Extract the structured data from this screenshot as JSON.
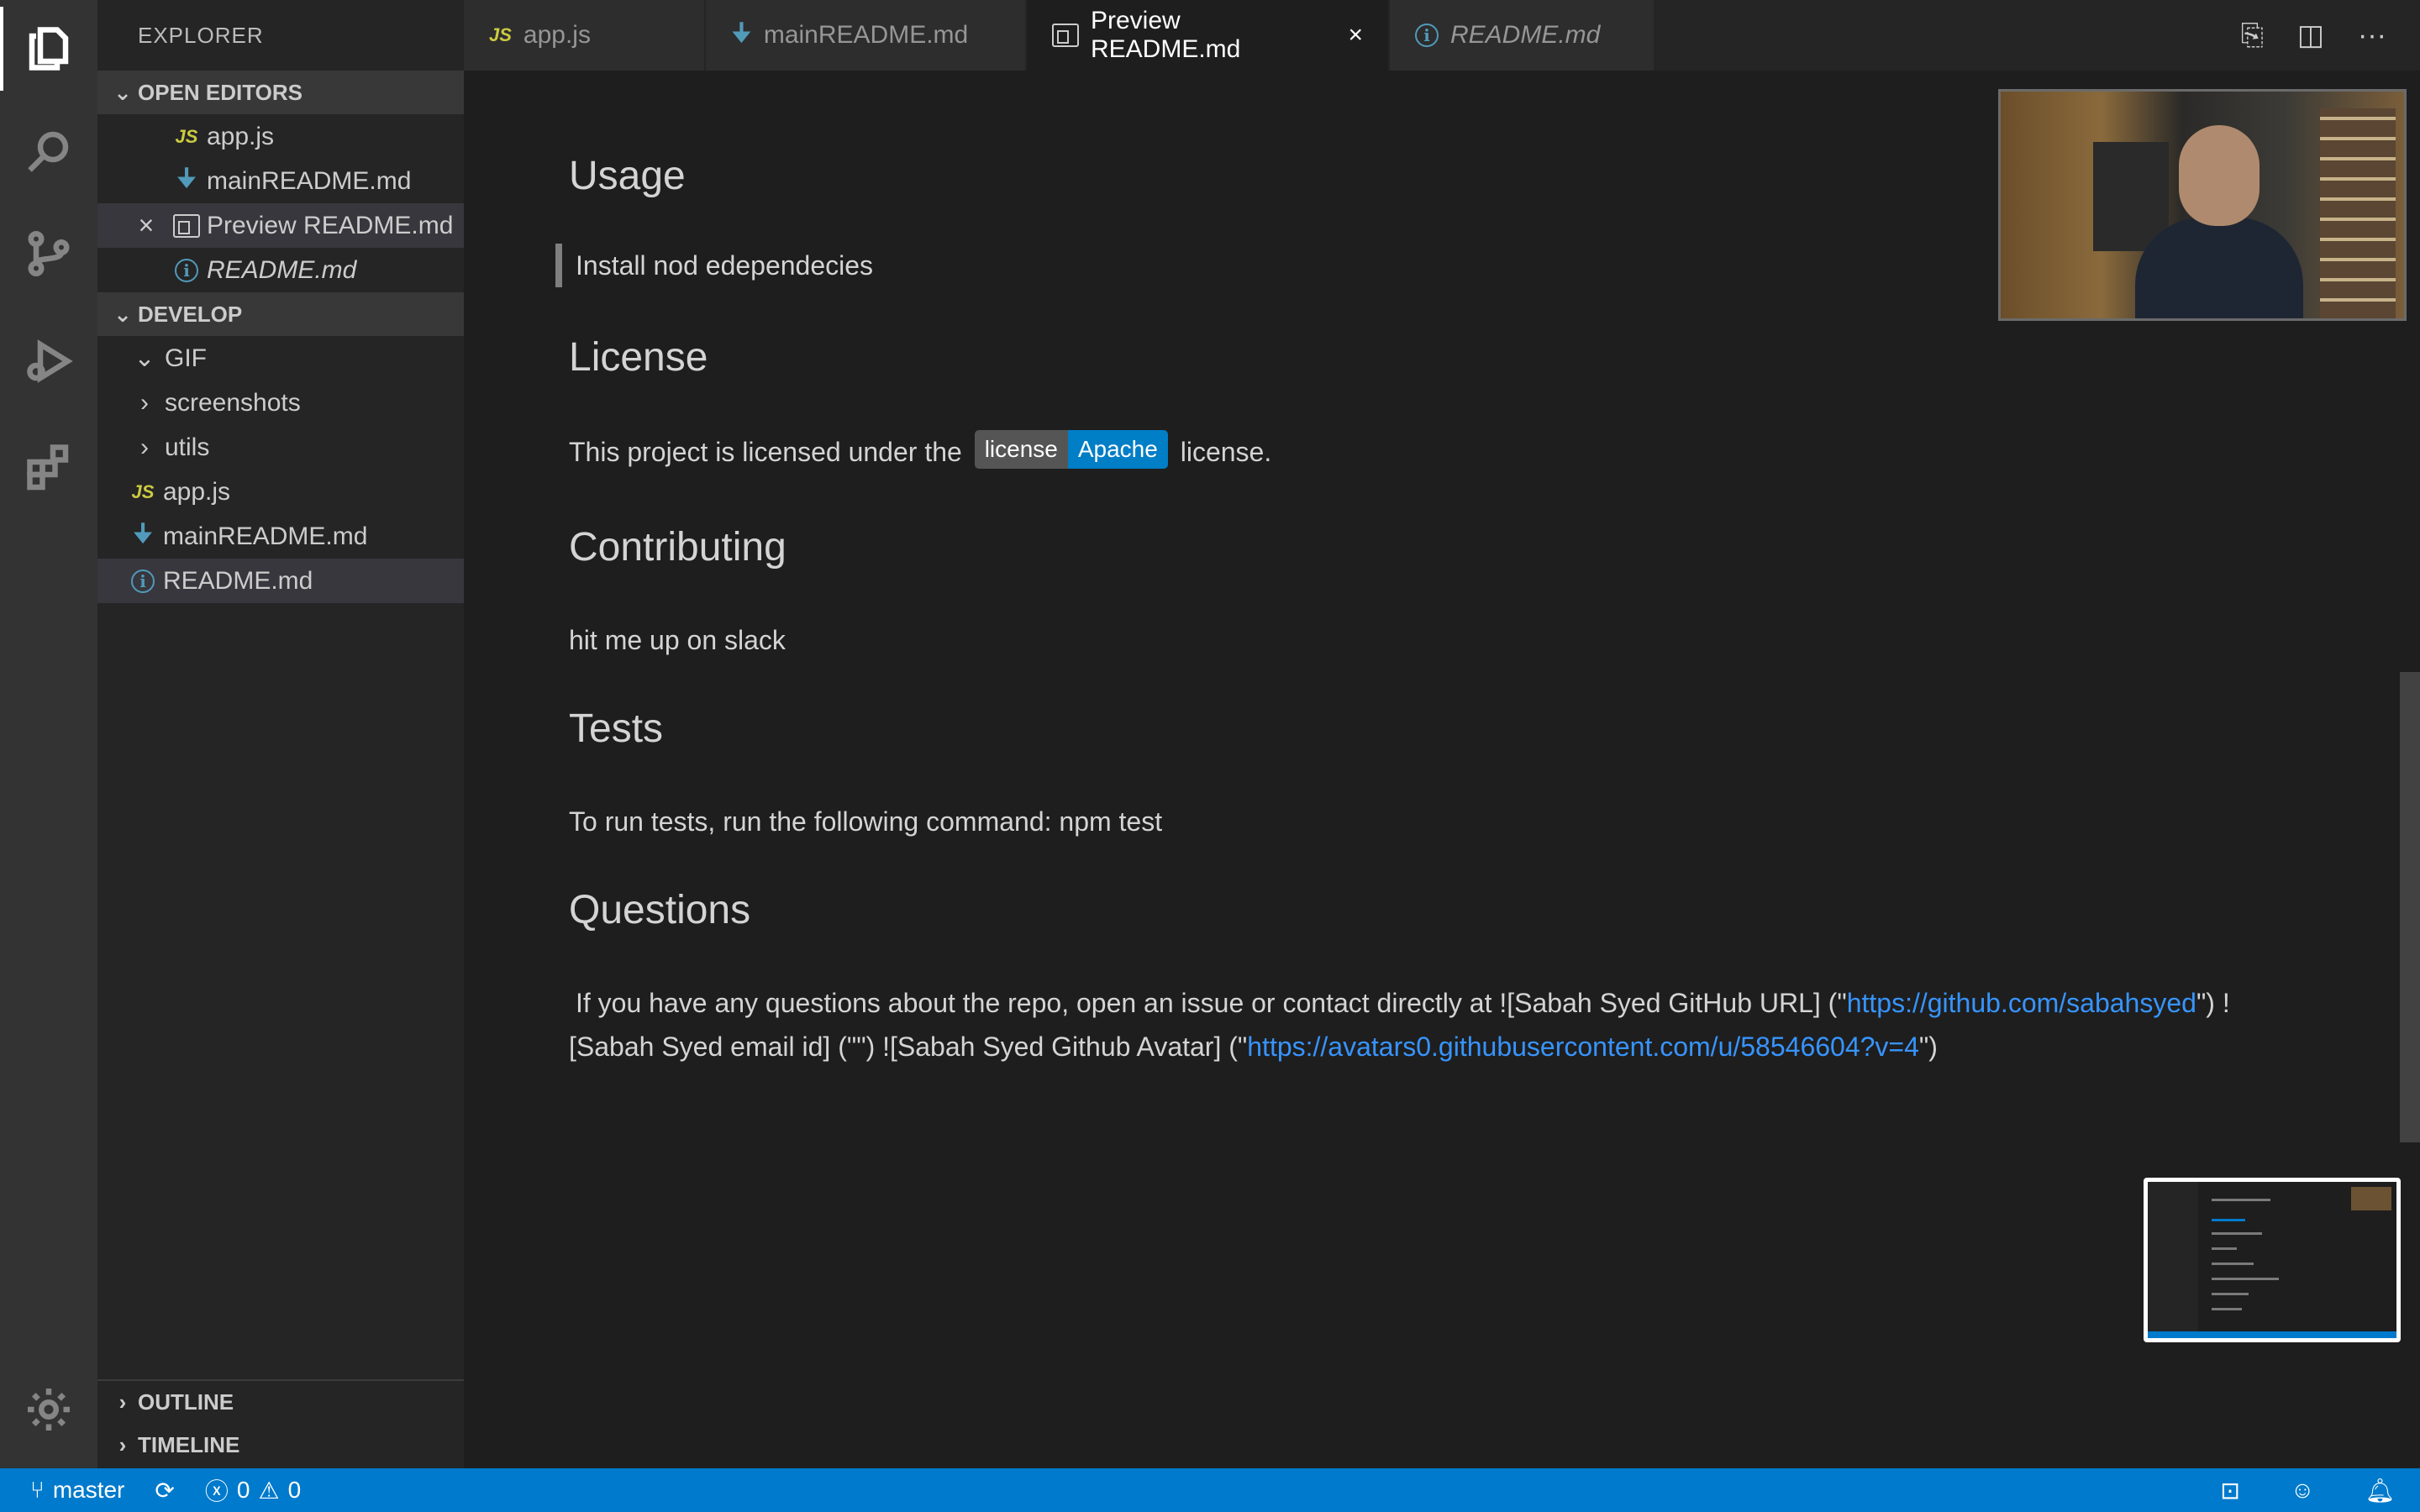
{
  "sidebar": {
    "title": "EXPLORER",
    "open_editors": {
      "header": "OPEN EDITORS",
      "items": [
        {
          "label": "app.js",
          "icon": "js-icon"
        },
        {
          "label": "mainREADME.md",
          "icon": "markdown-arrow-icon"
        },
        {
          "label": "Preview README.md",
          "icon": "preview-icon"
        },
        {
          "label": "README.md",
          "icon": "info-icon"
        }
      ]
    },
    "develop": {
      "header": "DEVELOP",
      "items": [
        {
          "label": "GIF",
          "type": "folder-open"
        },
        {
          "label": "screenshots",
          "type": "folder-closed"
        },
        {
          "label": "utils",
          "type": "folder-closed"
        },
        {
          "label": "app.js",
          "type": "file"
        },
        {
          "label": "mainREADME.md",
          "type": "file"
        },
        {
          "label": "README.md",
          "type": "file"
        }
      ]
    },
    "outline_header": "OUTLINE",
    "timeline_header": "TIMELINE"
  },
  "tabs": [
    {
      "label": "app.js"
    },
    {
      "label": "mainREADME.md"
    },
    {
      "label": "Preview README.md"
    },
    {
      "label": "README.md"
    }
  ],
  "preview": {
    "usage_heading": "Usage",
    "usage_text": "Install nod edependecies",
    "license_heading": "License",
    "license_text_before": "This project is licensed under the",
    "license_badge_left": "license",
    "license_badge_right": "Apache",
    "license_text_after": "license.",
    "contributing_heading": "Contributing",
    "contributing_text": "hit me up on slack",
    "tests_heading": "Tests",
    "tests_text": "To run tests, run the following command: npm test",
    "questions_heading": "Questions",
    "questions_line1_before": "If you have any questions about the repo, open an issue or contact directly at ![Sabah Syed GitHub URL] (\"",
    "questions_link1": "https://github.com/sabahsyed",
    "questions_line1_after": "\") !",
    "questions_line2_before": "[Sabah Syed email id] (\"\") ![Sabah Syed Github Avatar] (\"",
    "questions_link2": "https://avatars0.githubusercontent.com/u/58546604?v=4",
    "questions_line2_after": "\")"
  },
  "statusbar": {
    "branch": "master",
    "errors": "0",
    "warnings": "0"
  },
  "colors": {
    "accent": "#007acc",
    "link": "#3794ff",
    "badge_right": "#007ec6"
  }
}
